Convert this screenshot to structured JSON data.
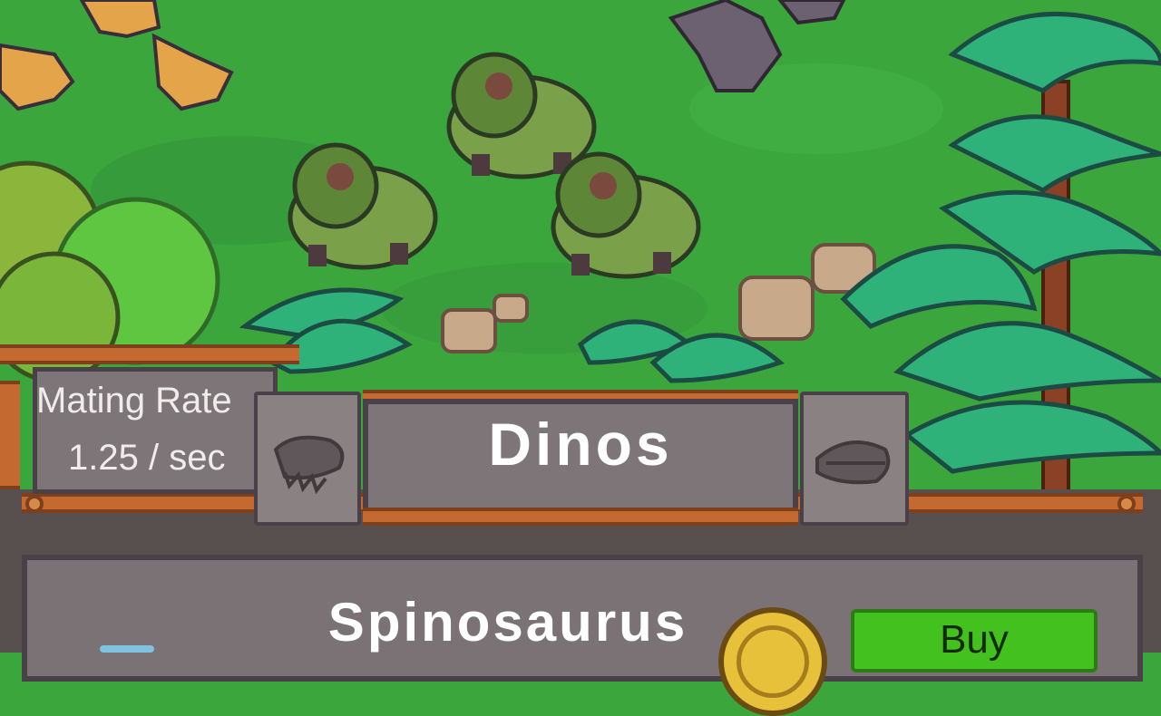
{
  "hud": {
    "mating_rate_label": "Mating Rate",
    "mating_rate_value": "1.25 / sec",
    "tab_title": "Dinos"
  },
  "shop_item": {
    "name": "Spinosaurus",
    "buy_label": "Buy"
  },
  "colors": {
    "grass": "#3aa63c",
    "panel": "#57504f",
    "beam": "#c46a31",
    "buy_button": "#43c21f",
    "coin": "#e8c13a"
  }
}
